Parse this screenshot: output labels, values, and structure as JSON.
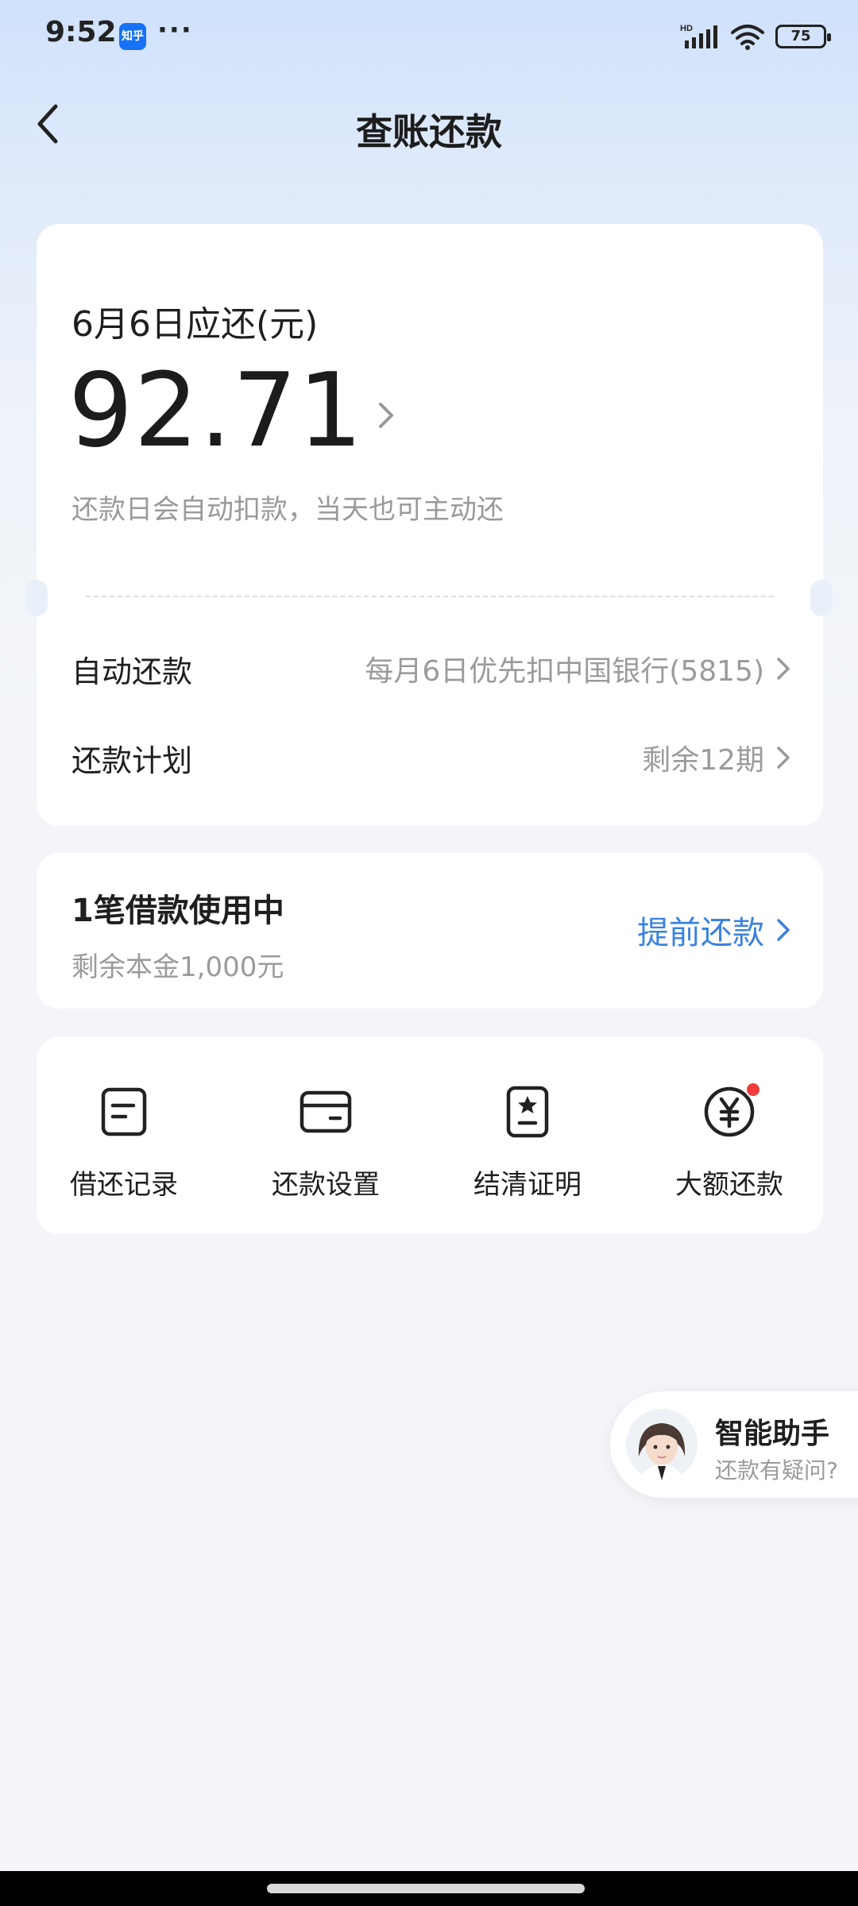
{
  "status_bar": {
    "time": "9:52",
    "app_badge": "知乎",
    "more": "···",
    "network": "HD",
    "battery": "75",
    "icons": [
      "signal-icon",
      "wifi-icon",
      "battery-icon"
    ]
  },
  "nav": {
    "back_icon": "chevron-left-icon",
    "title": "查账还款"
  },
  "bill": {
    "due_label": "6月6日应还(元)",
    "amount": "92.71",
    "note": "还款日会自动扣款，当天也可主动还",
    "rows": [
      {
        "label": "自动还款",
        "value": "每月6日优先扣中国银行(5815)"
      },
      {
        "label": "还款计划",
        "value": "剩余12期"
      }
    ]
  },
  "loan": {
    "title": "1笔借款使用中",
    "subtitle": "剩余本金1,000元",
    "action": "提前还款"
  },
  "actions": [
    {
      "label": "借还记录",
      "icon": "record-icon"
    },
    {
      "label": "还款设置",
      "icon": "wallet-icon"
    },
    {
      "label": "结清证明",
      "icon": "certificate-icon"
    },
    {
      "label": "大额还款",
      "icon": "yuan-icon"
    }
  ],
  "assistant": {
    "title": "智能助手",
    "subtitle": "还款有疑问?"
  },
  "colors": {
    "accent": "#3a82e0",
    "badge_red": "#f23b3b"
  }
}
